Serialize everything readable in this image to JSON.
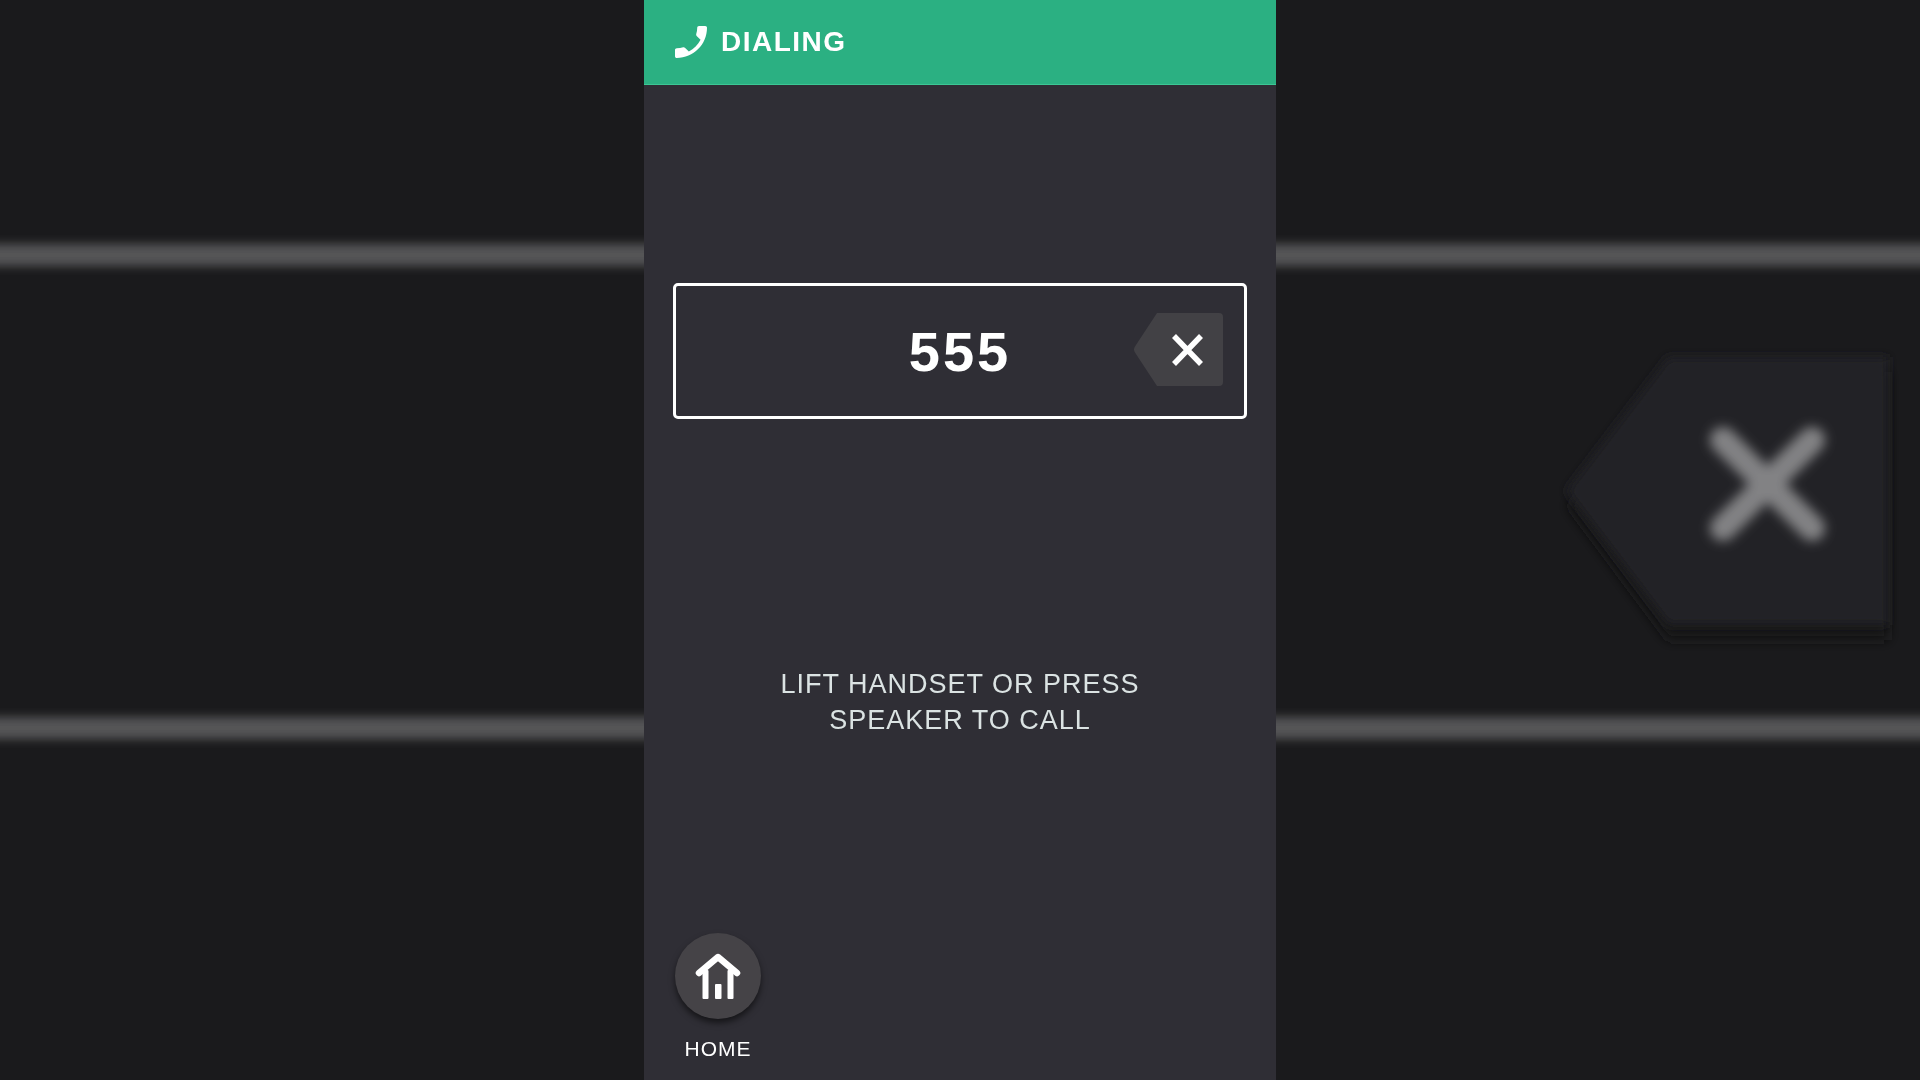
{
  "header": {
    "title": "DIALING"
  },
  "number_field": {
    "value": "555"
  },
  "prompt": "LIFT HANDSET OR PRESS SPEAKER TO CALL",
  "home_button": {
    "label": "HOME"
  }
}
